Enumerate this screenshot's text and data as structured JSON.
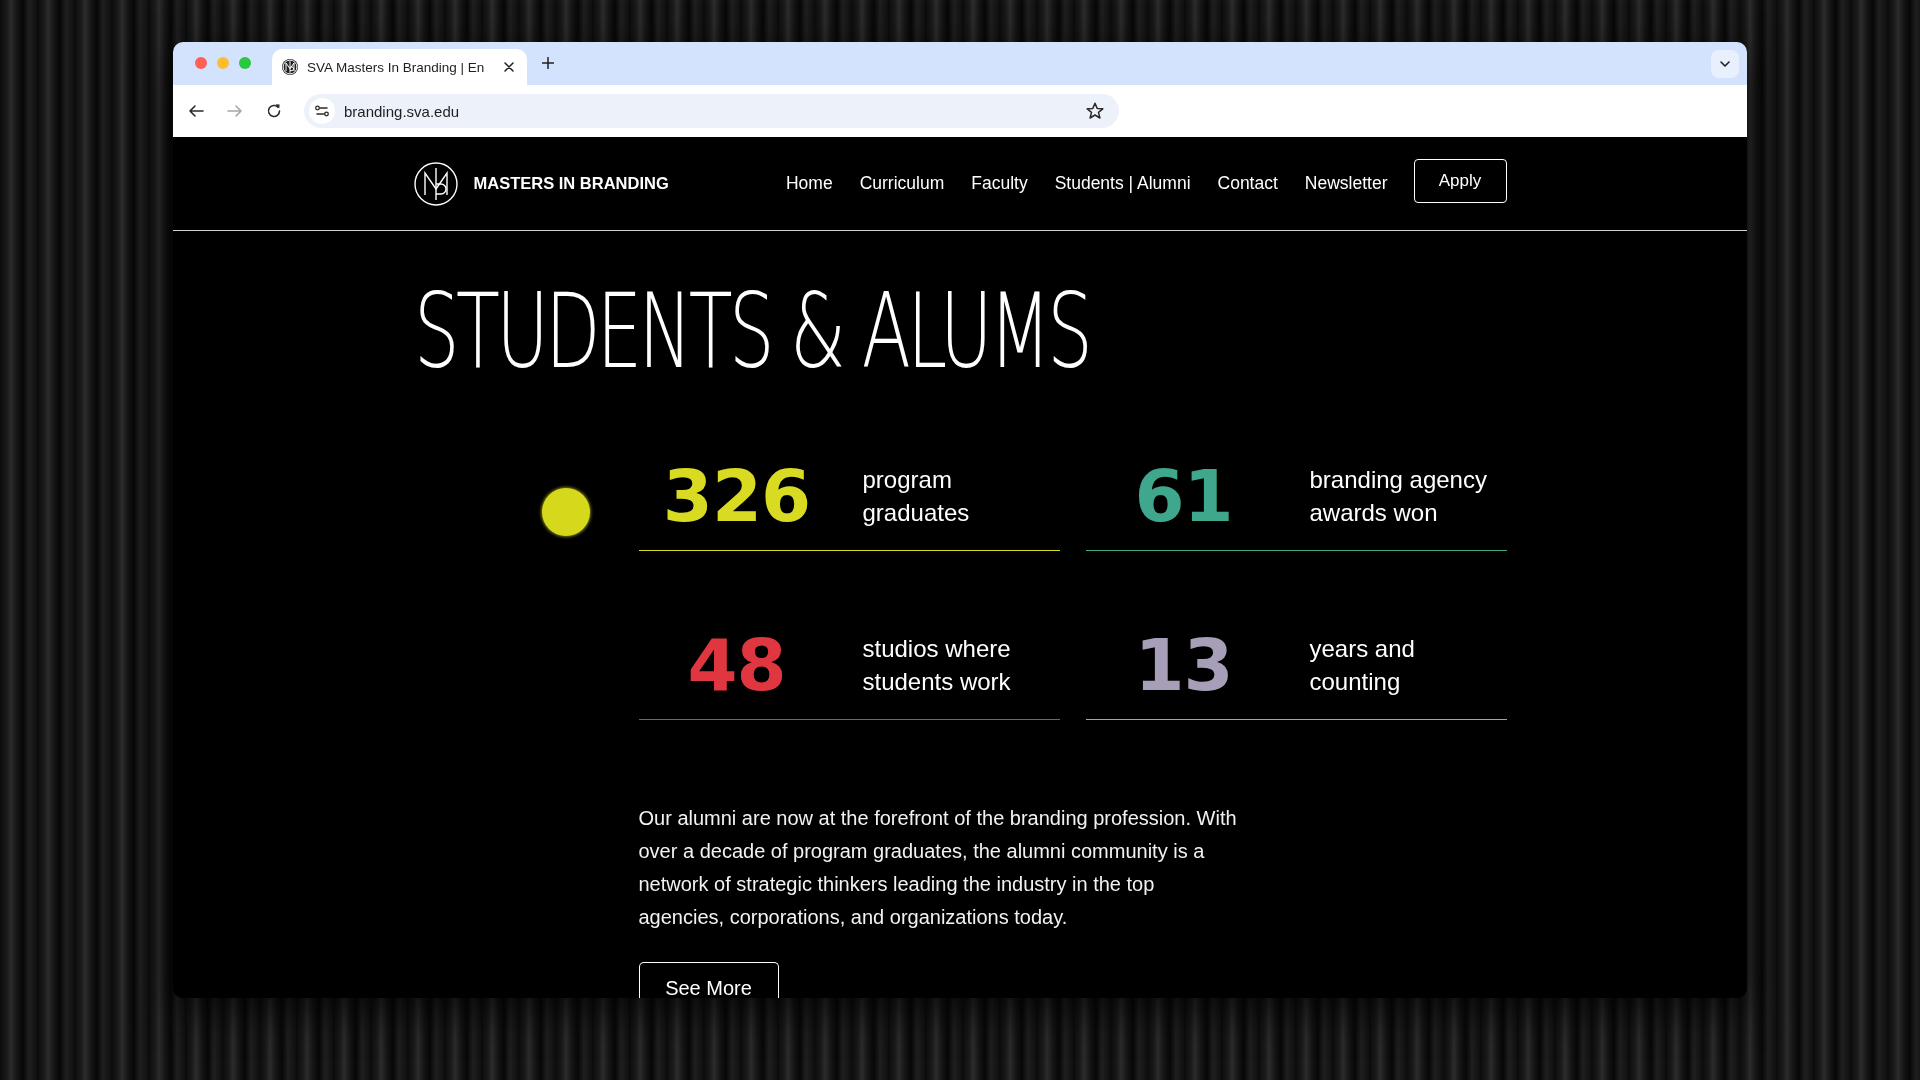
{
  "browser": {
    "tabs": [
      {
        "title": "SVA Masters In Branding | En",
        "selected": true
      }
    ],
    "nav_buttons": [
      {
        "kind": "back",
        "disabled": false
      },
      {
        "kind": "forward",
        "disabled": true
      },
      {
        "kind": "reload",
        "disabled": false
      }
    ],
    "address": "branding.sva.edu"
  },
  "header": {
    "brand": "MASTERS IN BRANDING",
    "nav": [
      "Home",
      "Curriculum",
      "Faculty",
      "Students | Alumni",
      "Contact",
      "Newsletter"
    ],
    "cta": "Apply"
  },
  "heading": "STUDENTS & ALUMS",
  "stats": [
    {
      "number": "326",
      "description": "program graduates",
      "color": "#d8db22"
    },
    {
      "number": "61",
      "description": "branding agency awards won",
      "color": "#3fa88c"
    },
    {
      "number": "48",
      "description": "studios where students work",
      "color": "#e0363f"
    },
    {
      "number": "13",
      "description": "years and counting",
      "color": "#a79fb8"
    }
  ],
  "intro": "Our alumni are now at the forefront of the branding profession. With over a decade of program graduates, the alumni community is a network of strategic thinkers leading the industry in the top agencies, corporations, and organizations today.",
  "button": "See More"
}
